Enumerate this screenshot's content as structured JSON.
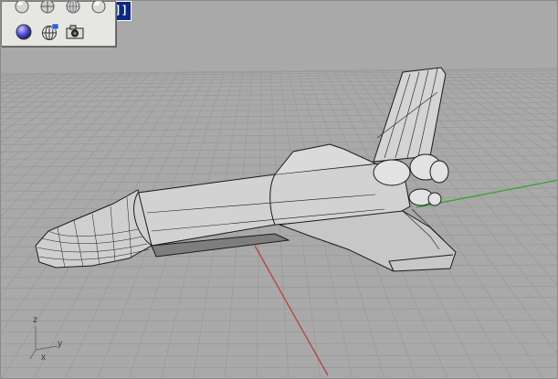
{
  "app": {
    "title_strip_tail": "]]"
  },
  "toolbar": {
    "tools": [
      {
        "icon": "wireframe-sphere-icon"
      },
      {
        "icon": "shaded-sphere-icon"
      },
      {
        "icon": "rendered-sphere-icon"
      },
      {
        "icon": "ghosted-sphere-icon"
      },
      {
        "icon": "render-preview-sphere-icon"
      },
      {
        "icon": "environment-globe-icon"
      },
      {
        "icon": "camera-icon"
      }
    ]
  },
  "viewport": {
    "background": "#a9a9a9",
    "grid_color": "#9a9a9a",
    "x_axis_color": "#b84040",
    "y_axis_color": "#2fa52f",
    "axis_triad": {
      "z_label": "z",
      "y_label": "y",
      "x_label": "x"
    }
  }
}
